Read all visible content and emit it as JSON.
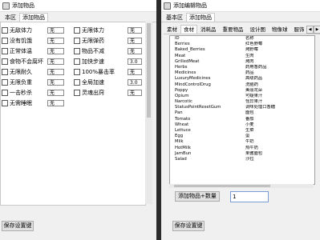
{
  "window_left": {
    "title": "添加物品",
    "tabs": [
      "本区",
      "添加物品"
    ],
    "options_col1": [
      {
        "label": "无敌体力",
        "value": "无"
      },
      {
        "label": "没有饥饿",
        "value": "无"
      },
      {
        "label": "正常体温",
        "value": "无"
      },
      {
        "label": "食物不会腐坏",
        "value": "无"
      },
      {
        "label": "无限耐久",
        "value": "无"
      },
      {
        "label": "无限负重",
        "value": "无"
      },
      {
        "label": "一击秒杀",
        "value": "无"
      },
      {
        "label": "无需睡眠",
        "value": "无"
      }
    ],
    "options_col2": [
      {
        "label": "无限体力",
        "value": "无"
      },
      {
        "label": "无限弹药",
        "value": "无"
      },
      {
        "label": "物品不减",
        "value": "无"
      },
      {
        "label": "加快步速",
        "value": "3.0"
      },
      {
        "label": "100%暴击率",
        "value": "无"
      },
      {
        "label": "全局加速",
        "value": "3.0"
      },
      {
        "label": "灵魂出窍",
        "value": "无"
      }
    ],
    "save_label": "保存设置键"
  },
  "window_right": {
    "title": "添加编辑物品",
    "tabs": [
      "基本区",
      "添加物品"
    ],
    "subtabs": [
      "素材",
      "食材",
      "消耗品",
      "重要物品",
      "设计图",
      "物像球",
      "服饰",
      "武器"
    ],
    "active_subtab": 1,
    "table": {
      "header": {
        "id": "ID",
        "name": "名称"
      },
      "rows": [
        {
          "id": "Berries",
          "name": "红色野莓"
        },
        {
          "id": "Baked_Berries",
          "name": "烤野莓"
        },
        {
          "id": "Meat",
          "name": "生肉"
        },
        {
          "id": "GrilledMeat",
          "name": "烤肉"
        },
        {
          "id": "Herbs",
          "name": "药用香药品"
        },
        {
          "id": "Medicines",
          "name": "药品"
        },
        {
          "id": "LuxuryMedicines",
          "name": "高级药品"
        },
        {
          "id": "MindControlDrug",
          "name": "洗脑药"
        },
        {
          "id": "Poppy",
          "name": "美丽花朵"
        },
        {
          "id": "Opium",
          "name": "可疑果汁"
        },
        {
          "id": "Narcotic",
          "name": "怪异果汁"
        },
        {
          "id": "StatusPointResetGum",
          "name": "调味处理口香糖"
        },
        {
          "id": "Pan",
          "name": "面包"
        },
        {
          "id": "Tomato",
          "name": "番茄"
        },
        {
          "id": "Wheat",
          "name": "小麦"
        },
        {
          "id": "Lettuce",
          "name": "生菜"
        },
        {
          "id": "Egg",
          "name": "蛋"
        },
        {
          "id": "Milk",
          "name": "牛奶"
        },
        {
          "id": "HotMilk",
          "name": "热牛奶"
        },
        {
          "id": "JamBun",
          "name": "果酱面包"
        },
        {
          "id": "Salad",
          "name": "沙拉"
        }
      ]
    },
    "add_button_label": "添加物品+数量",
    "quantity_value": "1",
    "save_label": "保存设置键"
  }
}
